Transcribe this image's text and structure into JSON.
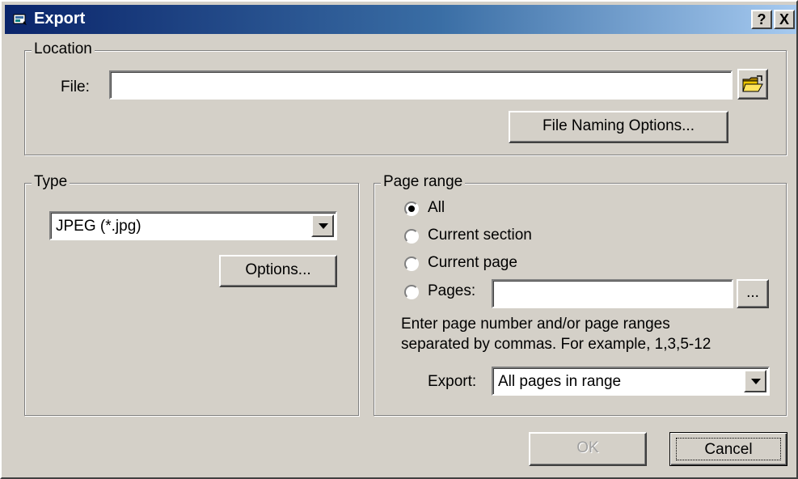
{
  "window": {
    "title": "Export",
    "help": "?",
    "close": "X"
  },
  "location": {
    "legend": "Location",
    "file_label": "File:",
    "file_value": "",
    "browse_icon": "folder-open-icon",
    "naming_button": "File Naming Options..."
  },
  "type": {
    "legend": "Type",
    "format_value": "JPEG (*.jpg)",
    "options_button": "Options..."
  },
  "page_range": {
    "legend": "Page range",
    "options": [
      {
        "label": "All",
        "selected": true
      },
      {
        "label": "Current section",
        "selected": false
      },
      {
        "label": "Current page",
        "selected": false
      },
      {
        "label": "Pages:",
        "selected": false
      }
    ],
    "pages_value": "",
    "pages_browse": "...",
    "hint_line1": "Enter page number and/or page ranges",
    "hint_line2": "separated by commas.  For example, 1,3,5-12",
    "export_label": "Export:",
    "export_value": "All pages in range"
  },
  "buttons": {
    "ok": "OK",
    "cancel": "Cancel",
    "ok_enabled": false
  }
}
